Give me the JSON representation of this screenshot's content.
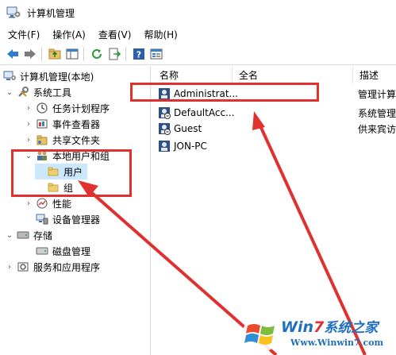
{
  "window": {
    "title": "计算机管理"
  },
  "menu": [
    "文件(F)",
    "操作(A)",
    "查看(V)",
    "帮助(H)"
  ],
  "toolbar_icons": [
    "back-arrow-icon",
    "forward-arrow-icon",
    "up-folder-icon",
    "show-tree-icon",
    "refresh-icon",
    "export-icon",
    "help-icon",
    "properties-icon"
  ],
  "tree": [
    {
      "label": "计算机管理(本地)",
      "icon": "computer-management-icon"
    },
    {
      "label": "系统工具",
      "icon": "tools-icon"
    },
    {
      "label": "任务计划程序",
      "icon": "clock-icon"
    },
    {
      "label": "事件查看器",
      "icon": "event-viewer-icon"
    },
    {
      "label": "共享文件夹",
      "icon": "shared-folder-icon"
    },
    {
      "label": "本地用户和组",
      "icon": "users-icon"
    },
    {
      "label": "用户",
      "icon": "folder-icon"
    },
    {
      "label": "组",
      "icon": "folder-icon"
    },
    {
      "label": "性能",
      "icon": "performance-icon"
    },
    {
      "label": "设备管理器",
      "icon": "device-manager-icon"
    },
    {
      "label": "存储",
      "icon": "storage-icon"
    },
    {
      "label": "磁盘管理",
      "icon": "disk-icon"
    },
    {
      "label": "服务和应用程序",
      "icon": "services-icon"
    }
  ],
  "list": {
    "columns": [
      "名称",
      "全名",
      "描述"
    ],
    "rows": [
      {
        "name": "Administrat...",
        "fullname": "",
        "desc": "管理计算"
      },
      {
        "name": "DefaultAcc...",
        "fullname": "",
        "desc": "系统管理"
      },
      {
        "name": "Guest",
        "fullname": "",
        "desc": "供来宾访"
      },
      {
        "name": "JON-PC",
        "fullname": "",
        "desc": ""
      }
    ]
  },
  "watermark": {
    "brand_win": "Win",
    "brand_7": "7",
    "brand_cn": "系统之家",
    "url": "Www.Winwin7.com"
  },
  "colors": {
    "annotation": "#e03131",
    "selection": "#cce8ff",
    "accent": "#1a73c9"
  }
}
